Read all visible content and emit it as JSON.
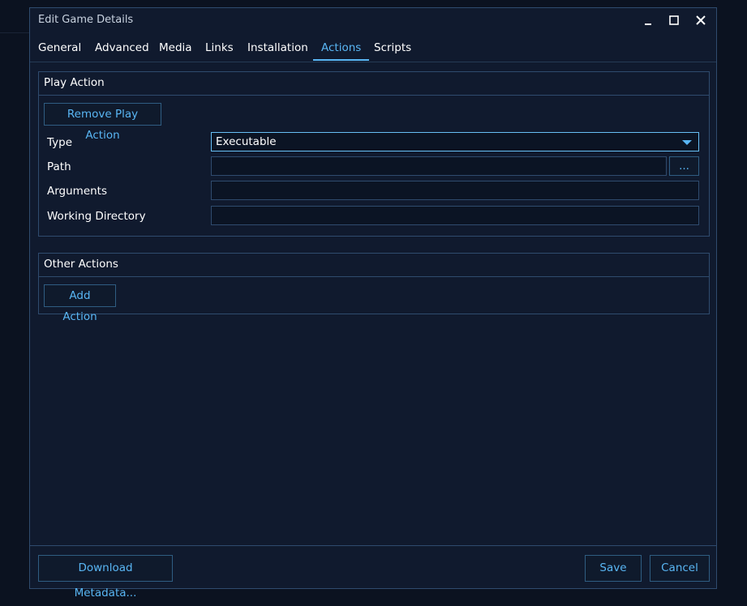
{
  "window": {
    "title": "Edit Game Details"
  },
  "tabs": [
    {
      "label": "General"
    },
    {
      "label": "Advanced"
    },
    {
      "label": "Media"
    },
    {
      "label": "Links"
    },
    {
      "label": "Installation"
    },
    {
      "label": "Actions"
    },
    {
      "label": "Scripts"
    }
  ],
  "active_tab": "Actions",
  "play_action": {
    "header": "Play Action",
    "remove_button": "Remove Play Action",
    "type_label": "Type",
    "type_value": "Executable",
    "path_label": "Path",
    "path_value": "",
    "browse_button": "...",
    "arguments_label": "Arguments",
    "arguments_value": "",
    "working_dir_label": "Working Directory",
    "working_dir_value": ""
  },
  "other_actions": {
    "header": "Other Actions",
    "add_button": "Add Action"
  },
  "footer": {
    "download_metadata": "Download Metadata...",
    "save": "Save",
    "cancel": "Cancel"
  },
  "colors": {
    "accent": "#59b6f4",
    "background": "#101a2e",
    "border": "#2f4b6e"
  }
}
